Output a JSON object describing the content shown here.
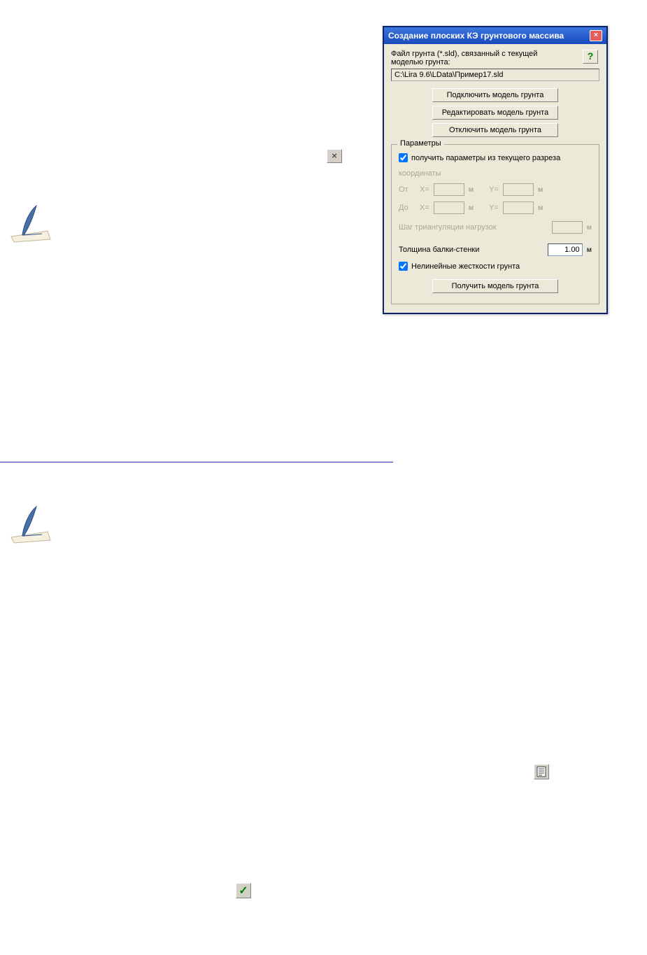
{
  "dialog": {
    "title": "Создание плоских КЭ грунтового массива",
    "file_label": "Файл грунта (*.sld), связанный с текущей моделью грунта:",
    "path": "C:\\Lira 9.6\\LData\\Пример17.sld",
    "help_symbol": "?",
    "close_symbol": "×",
    "buttons": {
      "connect": "Подключить модель грунта",
      "edit": "Редактировать модель грунта",
      "disconnect": "Отключить модель грунта",
      "get": "Получить модель грунта"
    },
    "params": {
      "group_title": "Параметры",
      "cb_from_section": "получить параметры из текущего разреза",
      "coords_label": "координаты",
      "from_label": "От",
      "to_label": "До",
      "x_label": "X=",
      "y_label": "Y=",
      "unit_m": "м",
      "step_label": "Шаг триангуляции нагрузок",
      "thickness_label": "Толщина балки-стенки",
      "thickness_value": "1.00",
      "cb_nonlinear": "Нелинейные жесткости грунта"
    }
  },
  "icons": {
    "close_x": "×",
    "checkmark": "✓"
  }
}
